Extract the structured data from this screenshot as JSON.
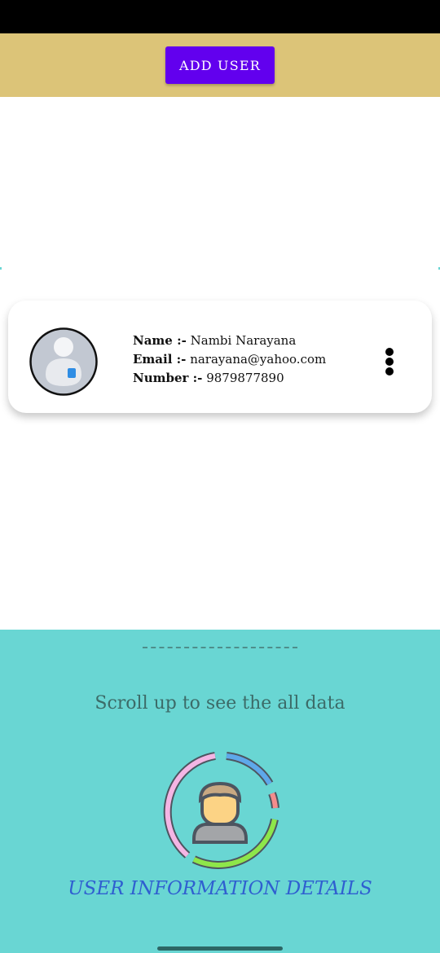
{
  "header": {
    "add_user_label": "ADD USER"
  },
  "user_card": {
    "name_label": "Name :-",
    "name_value": "Nambi Narayana",
    "email_label": "Email :-",
    "email_value": "narayana@yahoo.com",
    "number_label": "Number :-",
    "number_value": "9879877890",
    "avatar_icon": "user-avatar-icon",
    "menu_icon": "more-vertical-icon"
  },
  "footer": {
    "scroll_hint": "Scroll up to see the all data",
    "title": "USER INFORMATION DETAILS",
    "illustration_icon": "user-info-chart-icon"
  },
  "colors": {
    "header_bg": "#dcc478",
    "button_bg": "#6200ee",
    "footer_bg": "#69d6d3",
    "title_color": "#2f5fd0"
  }
}
